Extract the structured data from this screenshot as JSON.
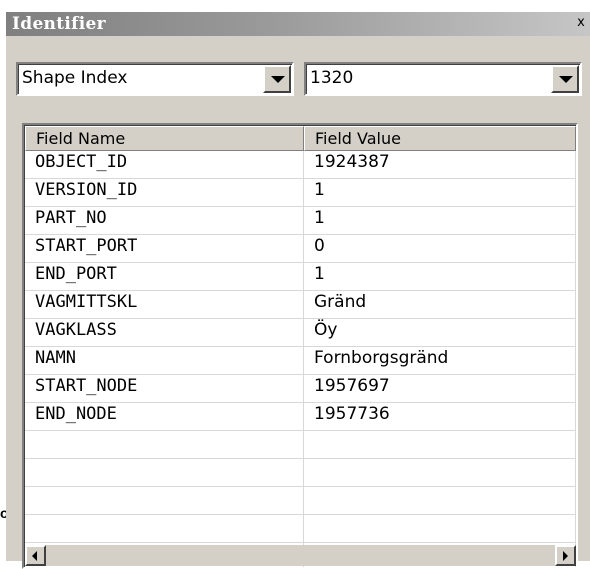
{
  "window": {
    "title": "Identifier",
    "close_label": "x"
  },
  "selectors": {
    "layer": {
      "value": "Shape Index"
    },
    "shape": {
      "value": "1320"
    }
  },
  "table": {
    "columns": [
      "Field Name",
      "Field Value"
    ],
    "rows": [
      [
        "OBJECT_ID",
        "1924387"
      ],
      [
        "VERSION_ID",
        "1"
      ],
      [
        "PART_NO",
        "1"
      ],
      [
        "START_PORT",
        "0"
      ],
      [
        "END_PORT",
        "1"
      ],
      [
        "VAGMITTSKL",
        "Gränd"
      ],
      [
        "VAGKLASS",
        "Öy"
      ],
      [
        "NAMN",
        "Fornborgsgränd"
      ],
      [
        "START_NODE",
        "1957697"
      ],
      [
        "END_NODE",
        "1957736"
      ]
    ],
    "empty_rows": 5
  },
  "background_text": "or",
  "colors": {
    "face": "#d4d0c8",
    "title_gradient_start": "#7f7f7f",
    "title_gradient_end": "#c6c6c6"
  }
}
